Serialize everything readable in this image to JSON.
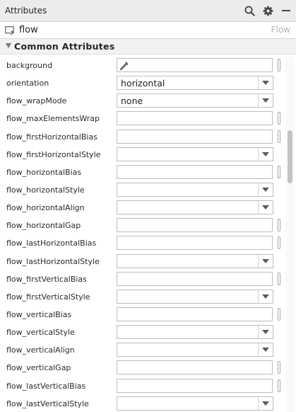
{
  "panel": {
    "title": "Attributes"
  },
  "toolbar": {
    "icons": [
      "search-icon",
      "gear-icon",
      "minimize-icon"
    ]
  },
  "component": {
    "name": "flow",
    "type": "Flow",
    "icon": "component-info-icon"
  },
  "section": {
    "title": "Common Attributes",
    "icon": "collapse-triangle-icon"
  },
  "attributes": [
    {
      "name": "background",
      "kind": "text",
      "value": "",
      "picker": true,
      "reference": true
    },
    {
      "name": "orientation",
      "kind": "combo",
      "value": "horizontal"
    },
    {
      "name": "flow_wrapMode",
      "kind": "combo",
      "value": "none"
    },
    {
      "name": "flow_maxElementsWrap",
      "kind": "text",
      "value": "",
      "reference": true
    },
    {
      "name": "flow_firstHorizontalBias",
      "kind": "text",
      "value": "",
      "reference": true
    },
    {
      "name": "flow_firstHorizontalStyle",
      "kind": "combo",
      "value": ""
    },
    {
      "name": "flow_horizontalBias",
      "kind": "text",
      "value": "",
      "reference": true
    },
    {
      "name": "flow_horizontalStyle",
      "kind": "combo",
      "value": ""
    },
    {
      "name": "flow_horizontalAlign",
      "kind": "combo",
      "value": ""
    },
    {
      "name": "flow_horizontalGap",
      "kind": "text",
      "value": "",
      "reference": true
    },
    {
      "name": "flow_lastHorizontalBias",
      "kind": "text",
      "value": "",
      "reference": true
    },
    {
      "name": "flow_lastHorizontalStyle",
      "kind": "combo",
      "value": ""
    },
    {
      "name": "flow_firstVerticalBias",
      "kind": "text",
      "value": "",
      "reference": true
    },
    {
      "name": "flow_firstVerticalStyle",
      "kind": "combo",
      "value": ""
    },
    {
      "name": "flow_verticalBias",
      "kind": "text",
      "value": "",
      "reference": true
    },
    {
      "name": "flow_verticalStyle",
      "kind": "combo",
      "value": ""
    },
    {
      "name": "flow_verticalAlign",
      "kind": "combo",
      "value": ""
    },
    {
      "name": "flow_verticalGap",
      "kind": "text",
      "value": "",
      "reference": true
    },
    {
      "name": "flow_lastVerticalBias",
      "kind": "text",
      "value": "",
      "reference": true
    },
    {
      "name": "flow_lastVerticalStyle",
      "kind": "combo",
      "value": ""
    }
  ]
}
